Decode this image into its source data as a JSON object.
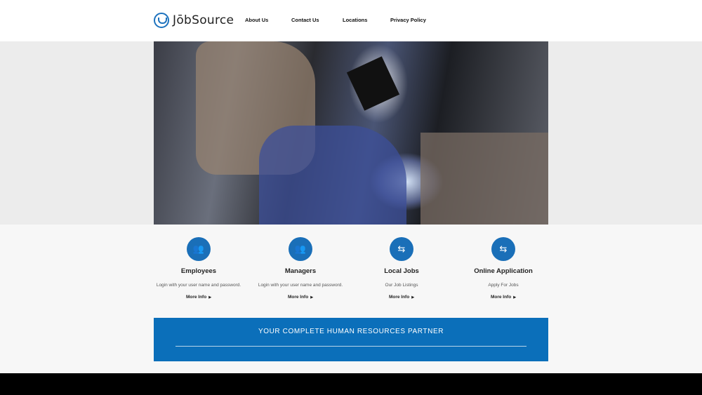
{
  "brand": {
    "name": "JōbSource",
    "accent": "#1e73be"
  },
  "nav": [
    "About Us",
    "Contact Us",
    "Locations",
    "Privacy Policy"
  ],
  "features": [
    {
      "icon": "users-icon",
      "title": "Employees",
      "desc": "Login with your user name and password.",
      "more": "More Info"
    },
    {
      "icon": "users-icon",
      "title": "Managers",
      "desc": "Login with your user name and password.",
      "more": "More Info"
    },
    {
      "icon": "swap-arrows-icon",
      "title": "Local Jobs",
      "desc": "Our Job Listings",
      "more": "More Info"
    },
    {
      "icon": "swap-arrows-icon",
      "title": "Online Application",
      "desc": "Apply For Jobs",
      "more": "More Info"
    }
  ],
  "banner": {
    "text": "YOUR COMPLETE HUMAN RESOURCES PARTNER",
    "color": "#0b6fba"
  }
}
